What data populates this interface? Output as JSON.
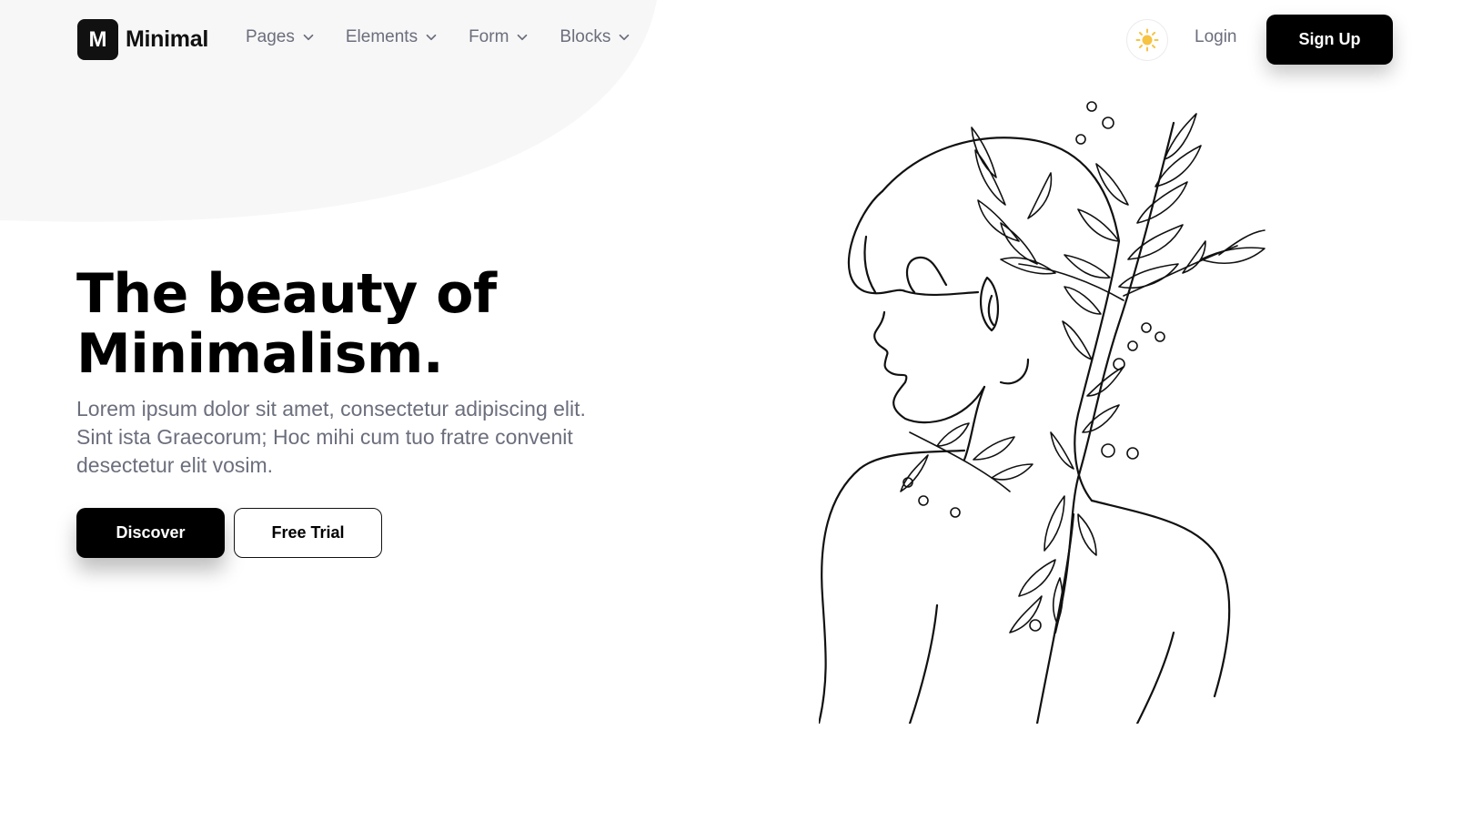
{
  "brand": {
    "logo_letter": "M",
    "name": "Minimal"
  },
  "nav": {
    "items": [
      {
        "label": "Pages"
      },
      {
        "label": "Elements"
      },
      {
        "label": "Form"
      },
      {
        "label": "Blocks"
      }
    ],
    "login_label": "Login",
    "signup_label": "Sign Up"
  },
  "hero": {
    "title_line1": "The beauty of",
    "title_line2": "Minimalism.",
    "text": "Lorem ipsum dolor sit amet, consectetur adipiscing elit. Sint ista Graecorum; Hoc mihi cum tuo fratre convenit desectetur elit vosim.",
    "discover_label": "Discover",
    "trial_label": "Free Trial"
  },
  "colors": {
    "primary": "#000000",
    "muted_text": "#6b6e7c",
    "blob": "#f7f7f7",
    "sun": "#f6c343"
  },
  "icons": {
    "theme": "sun-icon",
    "dropdown": "chevron-down-icon"
  }
}
